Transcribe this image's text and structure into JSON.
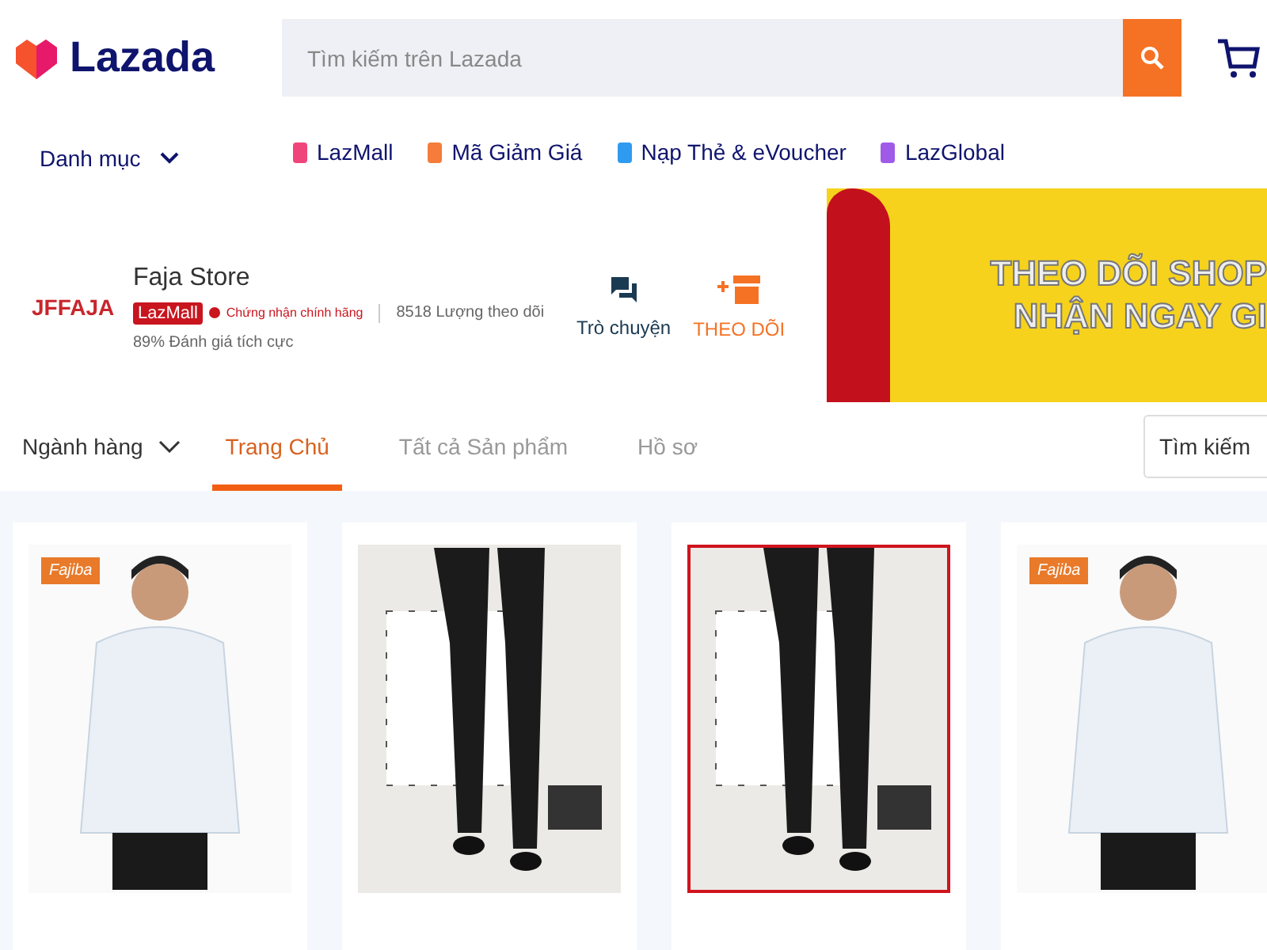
{
  "header": {
    "logo": "Lazada",
    "search": {
      "placeholder": "Tìm kiếm trên Lazada"
    }
  },
  "nav": {
    "category": "Danh mục",
    "links": [
      {
        "label": "LazMall",
        "color": "#f0457a"
      },
      {
        "label": "Mã Giảm Giá",
        "color": "#f57c3a"
      },
      {
        "label": "Nạp Thẻ & eVoucher",
        "color": "#2f9bf0"
      },
      {
        "label": "LazGlobal",
        "color": "#a05ae8"
      }
    ]
  },
  "store": {
    "logo": "JFFAJA",
    "name": "Faja Store",
    "badge": "LazMall",
    "certified": "Chứng nhận chính hãng",
    "followers": "8518 Lượng theo dõi",
    "rating": "89% Đánh giá tích cực",
    "chat": "Trò chuyện",
    "follow": "THEO DÕI"
  },
  "banner": {
    "lines": [
      "THEO DÕI SHOP",
      "NHẬN NGAY GI"
    ]
  },
  "tabs": {
    "category": "Ngành hàng",
    "items": [
      {
        "label": "Trang Chủ",
        "selected": true
      },
      {
        "label": "Tất cả Sản phẩm",
        "selected": false
      },
      {
        "label": "Hồ sơ",
        "selected": false
      }
    ],
    "search": {
      "placeholder": "Tìm kiếm"
    }
  },
  "products": [
    {
      "kind": "shirt",
      "selected": false,
      "brand": "Fajiba"
    },
    {
      "kind": "pants",
      "selected": false
    },
    {
      "kind": "pants",
      "selected": true
    },
    {
      "kind": "shirt",
      "selected": false,
      "brand": "Fajiba"
    }
  ]
}
